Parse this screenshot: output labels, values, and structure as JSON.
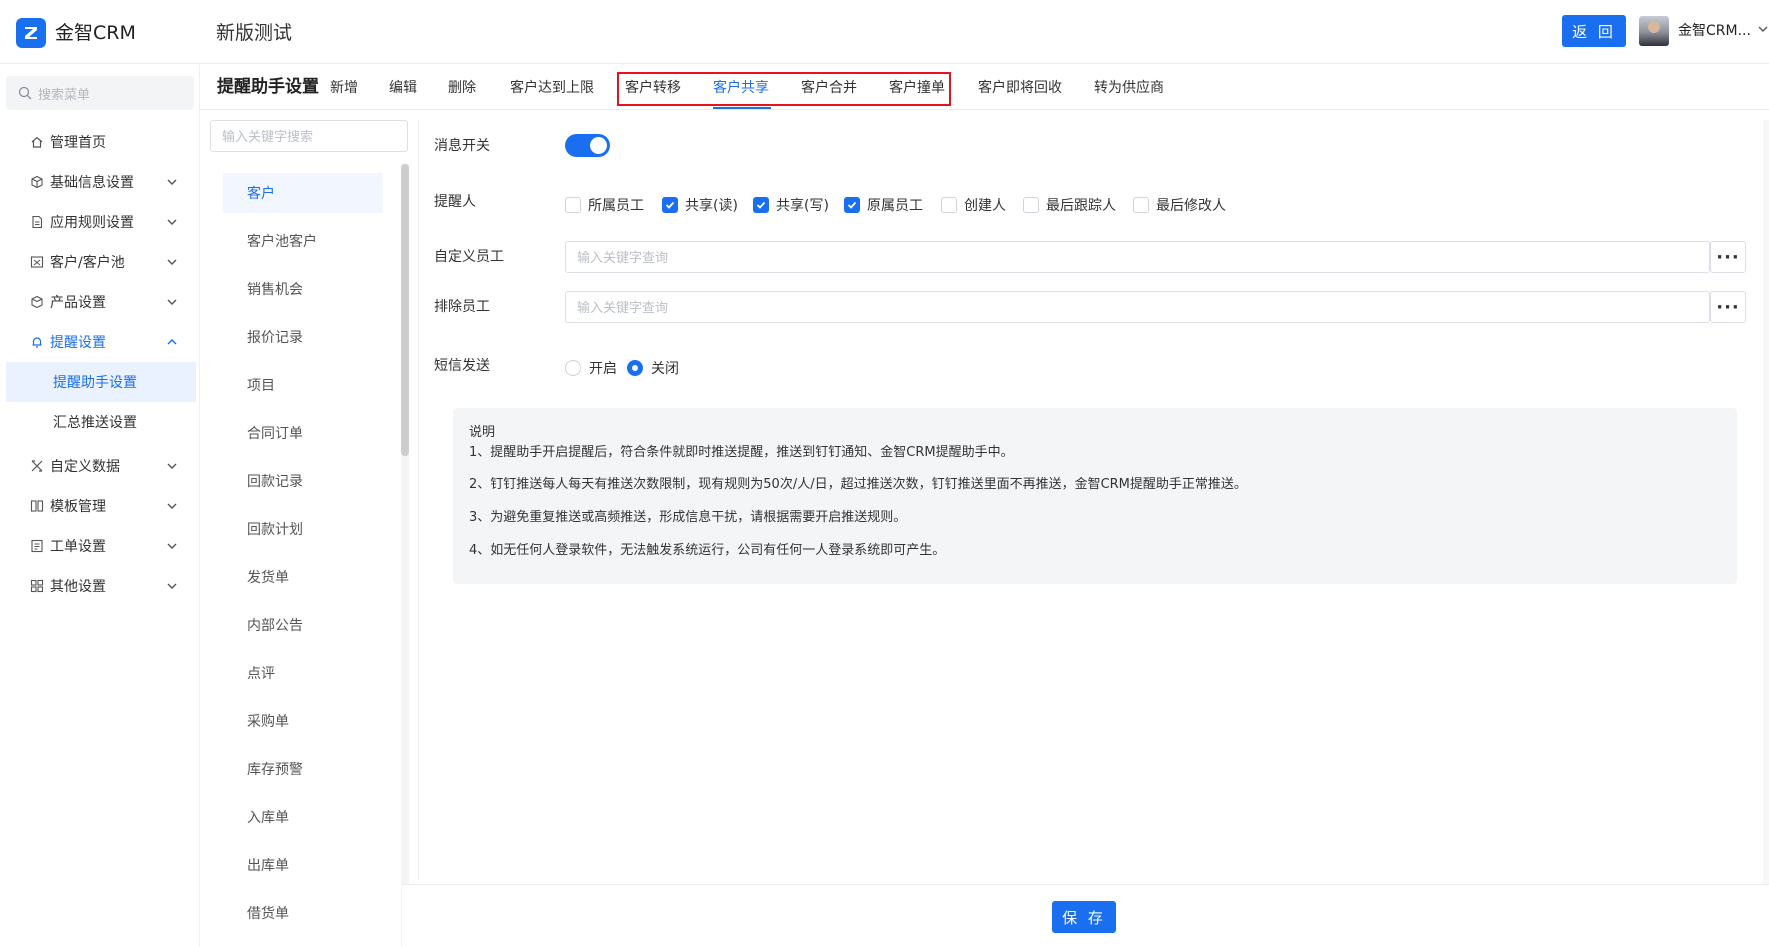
{
  "header": {
    "brand": "金智CRM",
    "app_title": "新版测试",
    "back_label": "返 回",
    "user_name": "金智CRM...",
    "accent_color": "#1a6ff0"
  },
  "sidebar": {
    "search_placeholder": "搜索菜单",
    "items": [
      {
        "label": "管理首页",
        "icon": "home-icon"
      },
      {
        "label": "基础信息设置",
        "icon": "cube-icon"
      },
      {
        "label": "应用规则设置",
        "icon": "file-icon"
      },
      {
        "label": "客户/客户池",
        "icon": "customer-icon"
      },
      {
        "label": "产品设置",
        "icon": "box-icon"
      },
      {
        "label": "提醒设置",
        "icon": "bell-icon"
      },
      {
        "label": "自定义数据",
        "icon": "tools-icon"
      },
      {
        "label": "模板管理",
        "icon": "template-icon"
      },
      {
        "label": "工单设置",
        "icon": "ticket-icon"
      },
      {
        "label": "其他设置",
        "icon": "grid-icon"
      }
    ],
    "sub_items": [
      {
        "label": "提醒助手设置"
      },
      {
        "label": "汇总推送设置"
      }
    ]
  },
  "tabbar": {
    "section_title": "提醒助手设置",
    "tabs": [
      {
        "label": "新增"
      },
      {
        "label": "编辑"
      },
      {
        "label": "删除"
      },
      {
        "label": "客户达到上限"
      },
      {
        "label": "客户转移"
      },
      {
        "label": "客户共享"
      },
      {
        "label": "客户合并"
      },
      {
        "label": "客户撞单"
      },
      {
        "label": "客户即将回收"
      },
      {
        "label": "转为供应商"
      }
    ],
    "active_tab": "客户共享"
  },
  "module_panel": {
    "search_placeholder": "输入关键字搜索",
    "items": [
      {
        "label": "客户"
      },
      {
        "label": "客户池客户"
      },
      {
        "label": "销售机会"
      },
      {
        "label": "报价记录"
      },
      {
        "label": "项目"
      },
      {
        "label": "合同订单"
      },
      {
        "label": "回款记录"
      },
      {
        "label": "回款计划"
      },
      {
        "label": "发货单"
      },
      {
        "label": "内部公告"
      },
      {
        "label": "点评"
      },
      {
        "label": "采购单"
      },
      {
        "label": "库存预警"
      },
      {
        "label": "入库单"
      },
      {
        "label": "出库单"
      },
      {
        "label": "借货单"
      }
    ],
    "active_item": "客户"
  },
  "settings": {
    "message_switch_label": "消息开关",
    "message_switch_on": true,
    "reminder_label": "提醒人",
    "reminders": [
      {
        "label": "所属员工",
        "checked": false
      },
      {
        "label": "共享(读)",
        "checked": true
      },
      {
        "label": "共享(写)",
        "checked": true
      },
      {
        "label": "原属员工",
        "checked": true
      },
      {
        "label": "创建人",
        "checked": false
      },
      {
        "label": "最后跟踪人",
        "checked": false
      },
      {
        "label": "最后修改人",
        "checked": false
      }
    ],
    "custom_staff_label": "自定义员工",
    "custom_staff_placeholder": "输入关键字查询",
    "exclude_staff_label": "排除员工",
    "exclude_staff_placeholder": "输入关键字查询",
    "sms_label": "短信发送",
    "sms_options": [
      {
        "label": "开启",
        "selected": false
      },
      {
        "label": "关闭",
        "selected": true
      }
    ]
  },
  "note": {
    "title": "说明",
    "lines": [
      "1、提醒助手开启提醒后，符合条件就即时推送提醒，推送到钉钉通知、金智CRM提醒助手中。",
      "2、钉钉推送每人每天有推送次数限制，现有规则为50次/人/日，超过推送次数，钉钉推送里面不再推送，金智CRM提醒助手正常推送。",
      "3、为避免重复推送或高频推送，形成信息干扰，请根据需要开启推送规则。",
      "4、如无任何人登录软件，无法触发系统运行，公司有任何一人登录系统即可产生。"
    ]
  },
  "footer": {
    "save_label": "保 存"
  }
}
